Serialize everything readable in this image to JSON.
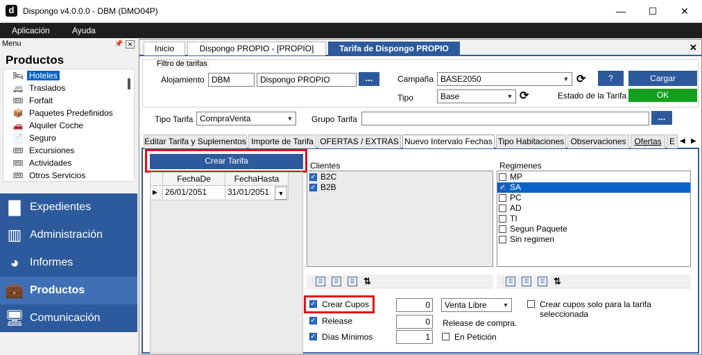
{
  "window": {
    "app_letter": "d",
    "title": "Dispongo v4.0.0.0 - DBM (DMO04P)",
    "min": "—",
    "max": "☐",
    "close": "✕"
  },
  "menubar": {
    "items": [
      "Aplicación",
      "Ayuda"
    ]
  },
  "sidebar": {
    "menu_label": "Menu",
    "title": "Productos",
    "items": [
      {
        "label": "Hoteles",
        "icon": "bed-icon"
      },
      {
        "label": "Traslados",
        "icon": "van-icon"
      },
      {
        "label": "Forfait",
        "icon": "ticket-icon"
      },
      {
        "label": "Paquetes Predefinidos",
        "icon": "package-icon"
      },
      {
        "label": "Alquiler Coche",
        "icon": "car-icon"
      },
      {
        "label": "Seguro",
        "icon": "document-icon"
      },
      {
        "label": "Excursiones",
        "icon": "ticket-icon"
      },
      {
        "label": "Actividades",
        "icon": "ticket-icon"
      },
      {
        "label": "Otros Servicios",
        "icon": "ticket-icon"
      }
    ],
    "nav": [
      "Expedientes",
      "Administración",
      "Informes",
      "Productos",
      "Comunicación"
    ],
    "active_nav": "Productos"
  },
  "tabs": {
    "items": [
      "Inicio",
      "Dispongo PROPIO - [PROPIO]",
      "Tarifa de Dispongo PROPIO"
    ],
    "close": "✕"
  },
  "filter": {
    "legend": "Filtro de tarifas",
    "alojamiento_label": "Alojamiento",
    "alojamiento_code": "DBM",
    "alojamiento_name": "Dispongo PROPIO",
    "campana_label": "Campaña",
    "campana_value": "BASE2050",
    "tipo_label": "Tipo",
    "tipo_value": "Base",
    "help": "?",
    "cargar": "Cargar",
    "estado_label": "Estado de la Tarifa",
    "estado_value": "OK",
    "tipo_tarifa_label": "Tipo Tarifa",
    "tipo_tarifa_value": "CompraVenta",
    "grupo_tarifa_label": "Grupo Tarifa",
    "grupo_tarifa_value": "",
    "dots": "..."
  },
  "subtabs": [
    "Editar Tarifa y Suplementos",
    "Importe de Tarifa",
    "OFERTAS / EXTRAS",
    "Nuevo Intervalo Fechas",
    "Tipo Habitaciones",
    "Observaciones",
    "Ofertas",
    "E"
  ],
  "panel": {
    "crear_tarifa": "Crear Tarifa",
    "grid_headers": [
      "FechaDe",
      "FechaHasta"
    ],
    "grid_row": [
      "26/01/2051",
      "31/01/2051"
    ],
    "clientes_label": "Clientes",
    "clientes": [
      {
        "label": "B2C",
        "checked": true
      },
      {
        "label": "B2B",
        "checked": true
      }
    ],
    "regimenes_label": "Regimenes",
    "regimenes": [
      {
        "label": "MP",
        "checked": false
      },
      {
        "label": "SA",
        "checked": true
      },
      {
        "label": "PC",
        "checked": false
      },
      {
        "label": "AD",
        "checked": false
      },
      {
        "label": "TI",
        "checked": false
      },
      {
        "label": "Segun Paquete",
        "checked": false
      },
      {
        "label": "Sin regimen",
        "checked": false
      }
    ],
    "crear_cupos": "Crear Cupos",
    "crear_cupos_value": "0",
    "venta_value": "Venta Libre",
    "crear_cupos_solo": "Crear cupos solo para la tarifa seleccionada",
    "release": "Release",
    "release_value": "0",
    "release_compra": "Release de compra.",
    "dias_minimos": "Días Mínimos",
    "dias_minimos_value": "1",
    "en_peticion": "En Petición"
  },
  "colors": {
    "accent": "#2d5a9c",
    "ok": "#14a01c",
    "highlight": "#e01018",
    "selection": "#0a64c8"
  }
}
